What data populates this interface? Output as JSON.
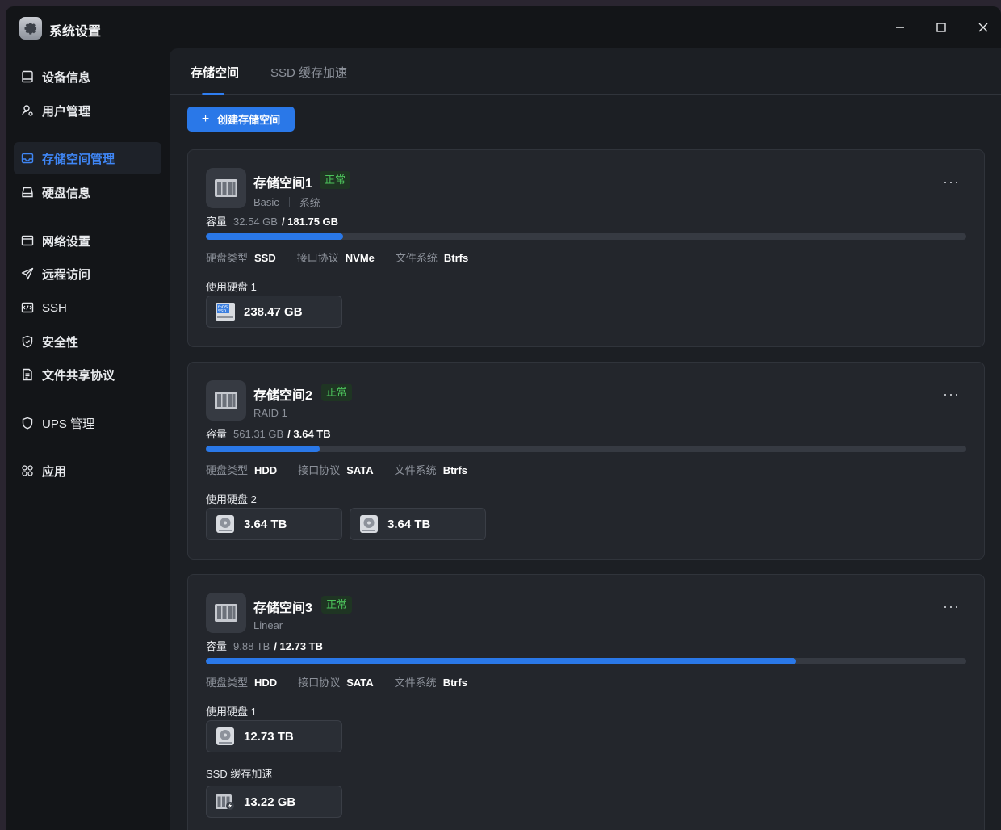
{
  "window": {
    "title": "系统设置"
  },
  "sidebar": {
    "items": [
      {
        "label": "设备信息",
        "icon": "monitor-icon"
      },
      {
        "label": "用户管理",
        "icon": "user-gear-icon"
      },
      {
        "label": "存储空间管理",
        "icon": "storage-icon",
        "active": true
      },
      {
        "label": "硬盘信息",
        "icon": "harddisk-icon"
      },
      {
        "label": "网络设置",
        "icon": "network-icon"
      },
      {
        "label": "远程访问",
        "icon": "send-icon"
      },
      {
        "label": "SSH",
        "icon": "ssh-terminal-icon"
      },
      {
        "label": "安全性",
        "icon": "shield-check-icon"
      },
      {
        "label": "文件共享协议",
        "icon": "document-icon"
      },
      {
        "label": "UPS 管理",
        "icon": "shield-icon"
      },
      {
        "label": "应用",
        "icon": "apps-grid-icon"
      }
    ]
  },
  "tabs": {
    "active": "存储空间",
    "inactive": "SSD 缓存加速"
  },
  "toolbar": {
    "create_label": "创建存储空间",
    "create_icon": "+"
  },
  "labels": {
    "capacity": "容量",
    "disk_type": "硬盘类型",
    "interface": "接口协议",
    "filesystem": "文件系统",
    "status": "正常",
    "more": "···"
  },
  "volumes": [
    {
      "name": "存储空间1",
      "status": "正常",
      "raid": "Basic",
      "tag": "系统",
      "used": "32.54 GB",
      "total": "/ 181.75 GB",
      "usage_pct": 18,
      "disk_type": "SSD",
      "interface": "NVMe",
      "filesystem": "Btrfs",
      "disks_label": "使用硬盘 1",
      "disks": [
        {
          "size": "238.47 GB",
          "icon": "nvme-ssd-icon",
          "icon_text": "fnOS SSD"
        }
      ]
    },
    {
      "name": "存储空间2",
      "status": "正常",
      "raid": "RAID 1",
      "used": "561.31 GB",
      "total": "/ 3.64 TB",
      "usage_pct": 15,
      "disk_type": "HDD",
      "interface": "SATA",
      "filesystem": "Btrfs",
      "disks_label": "使用硬盘 2",
      "disks": [
        {
          "size": "3.64 TB",
          "icon": "hdd-icon"
        },
        {
          "size": "3.64 TB",
          "icon": "hdd-icon"
        }
      ]
    },
    {
      "name": "存储空间3",
      "status": "正常",
      "raid": "Linear",
      "used": "9.88 TB",
      "total": "/ 12.73 TB",
      "usage_pct": 77.6,
      "disk_type": "HDD",
      "interface": "SATA",
      "filesystem": "Btrfs",
      "disks_label": "使用硬盘 1",
      "disks": [
        {
          "size": "12.73 TB",
          "icon": "hdd-icon"
        }
      ],
      "cache_label": "SSD 缓存加速",
      "cache": [
        {
          "size": "13.22 GB",
          "icon": "ssd-cache-icon"
        }
      ]
    }
  ]
}
